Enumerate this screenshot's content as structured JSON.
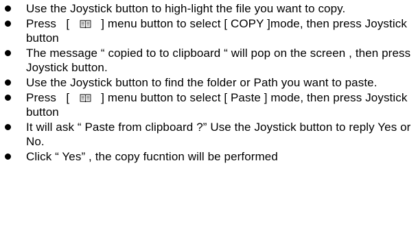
{
  "instructions": [
    {
      "text": "Use the Joystick button to high-light the file you want to copy."
    },
    {
      "before": "Press   [",
      "icon": "menu-book-icon",
      "after": "] menu button to select [ COPY ]mode, then press Joystick button"
    },
    {
      "text": "The message “ copied to to clipboard “ will pop on the screen , then press Joystick button."
    },
    {
      "text": "Use the Joystick button to find the folder or Path you want to paste."
    },
    {
      "before": "Press   [",
      "icon": "menu-book-icon",
      "after": "] menu button to select [ Paste ] mode, then press Joystick button"
    },
    {
      "text": "It will ask “ Paste from clipboard ?”   Use the Joystick button to reply Yes or No."
    },
    {
      "text": "Click “ Yes” , the copy fucntion will be performed"
    }
  ],
  "colors": {
    "text": "#000000",
    "background": "#ffffff"
  }
}
